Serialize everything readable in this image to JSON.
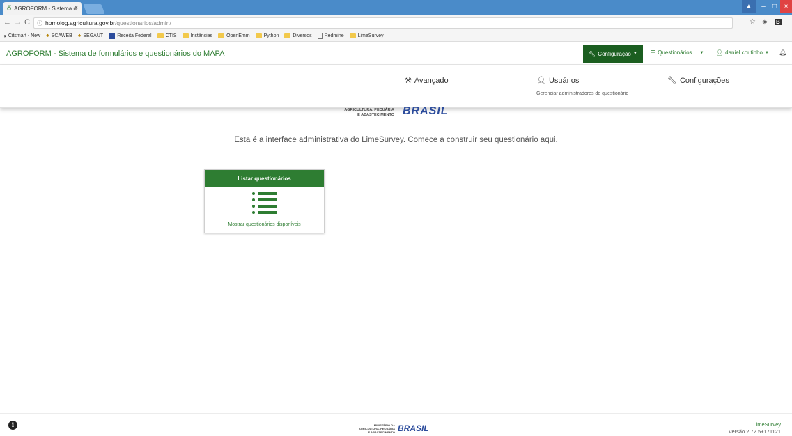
{
  "browser": {
    "tab_title": "AGROFORM - Sistema d",
    "tab_close": "×",
    "url_host": "homolog.agricultura.gov.br",
    "url_path": "/questionarios/admin/",
    "bookmarks": [
      {
        "label": "Citsmart - New",
        "icon": "globe-icon"
      },
      {
        "label": "SCAWEB",
        "icon": "people-icon"
      },
      {
        "label": "SEGAUT",
        "icon": "people-icon"
      },
      {
        "label": "Receita Federal",
        "icon": "shield-icon"
      },
      {
        "label": "CTIS",
        "icon": "folder-icon"
      },
      {
        "label": "Instâncias",
        "icon": "folder-icon"
      },
      {
        "label": "OpenEmm",
        "icon": "folder-icon"
      },
      {
        "label": "Python",
        "icon": "folder-icon"
      },
      {
        "label": "Diversos",
        "icon": "folder-icon"
      },
      {
        "label": "Redmine",
        "icon": "page-icon"
      },
      {
        "label": "LimeSurvey",
        "icon": "folder-icon"
      }
    ]
  },
  "navbar": {
    "brand": "AGROFORM - Sistema de formulários e questionários do MAPA",
    "config_label": "Configuração",
    "surveys_label": "Questionários",
    "user_label": "daniel.coutinho"
  },
  "menu": {
    "advanced": "Avançado",
    "users": "Usuários",
    "users_sub": "Gerenciar administradores de questionário",
    "settings": "Configurações"
  },
  "logo": {
    "ministry_line1": "AGRICULTURA, PECUÁRIA",
    "ministry_line2": "E ABASTECIMENTO",
    "brasil": "BRASIL"
  },
  "main": {
    "welcome": "Esta é a interface administrativa do LimeSurvey. Comece a construir seu questionário aqui.",
    "card_title": "Listar questionários",
    "card_link": "Mostrar questionários disponíveis"
  },
  "footer": {
    "logo_line1": "MINISTÉRIO DA",
    "logo_line2": "AGRICULTURA, PECUÁRIA",
    "logo_line3": "E ABASTECIMENTO",
    "brasil": "BRASIL",
    "product": "LimeSurvey",
    "version": "Versão 2.72.5+171121"
  },
  "colors": {
    "primary_green": "#2e7d32",
    "dark_green": "#1b5e20",
    "brasil_blue": "#2c4c9c"
  }
}
